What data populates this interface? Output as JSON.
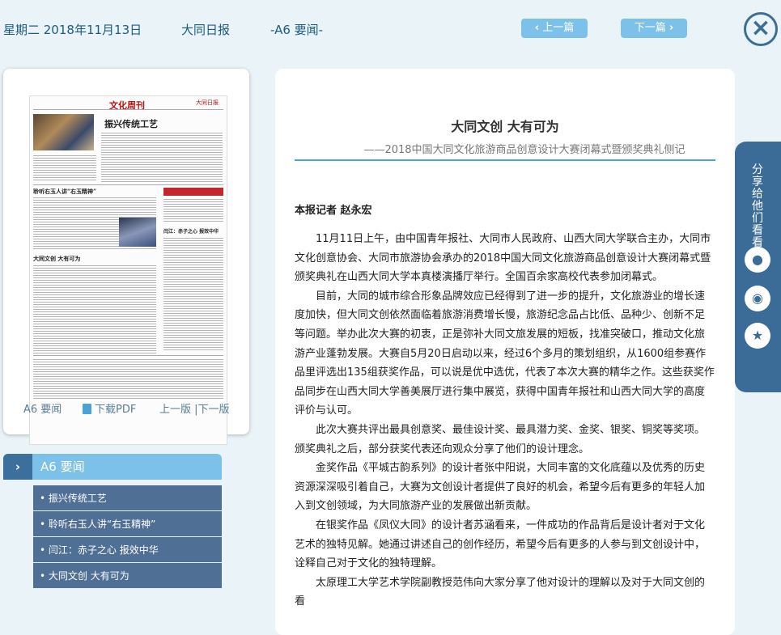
{
  "header": {
    "date": "星期二 2018年11月13日",
    "paper": "大同日报",
    "section": "-A6 要闻-",
    "prev_label": "上一篇",
    "next_label": "下一篇"
  },
  "thumbnail": {
    "masthead": "文化周刊",
    "headlines": [
      "振兴传统工艺",
      "聆听右玉人讲“右玉精神”",
      "大同文创  大有可为",
      "闫江：赤子之心  报效中华"
    ],
    "footer_section": "A6 要闻",
    "footer_pdf": "下载PDF",
    "footer_pages": "上一版 |下一版"
  },
  "article_list": {
    "heading": "A6 要闻",
    "items": [
      "• 振兴传统工艺",
      "• 聆听右玉人讲“右玉精神”",
      "• 闫江：赤子之心 报效中华",
      "• 大同文创 大有可为"
    ]
  },
  "article": {
    "title": "大同文创 大有可为",
    "subtitle": "——2018中国大同文化旅游商品创意设计大赛闭幕式暨颁奖典礼侧记",
    "byline": "本报记者 赵永宏",
    "paragraphs": [
      "11月11日上午，由中国青年报社、大同市人民政府、山西大同大学联合主办，大同市文化创意协会、大同市旅游协会承办的2018中国大同文化旅游商品创意设计大赛闭幕式暨颁奖典礼在山西大同大学本真楼演播厅举行。全国百余家高校代表参加闭幕式。",
      "目前，大同的城市综合形象品牌效应已经得到了进一步的提升，文化旅游业的增长速度加快，但大同文创依然面临着旅游消费增长慢，旅游纪念品占比低、品种少、创新不足等问题。举办此次大赛的初衷，正是弥补大同文旅发展的短板，找准突破口，推动文化旅游产业蓬勃发展。大赛自5月20日启动以来，经过6个多月的策划组织，从1600组参赛作品里评选出135组获奖作品，可以说是优中选优，代表了本次大赛的精华之作。这些获奖作品同步在山西大同大学善美展厅进行集中展览，获得中国青年报社和山西大同大学的高度评价与认可。",
      "此次大赛共评出最具创意奖、最佳设计奖、最具潜力奖、金奖、银奖、铜奖等奖项。颁奖典礼之后，部分获奖代表还向观众分享了他们的设计理念。",
      "金奖作品《平城古韵系列》的设计者张中阳说，大同丰富的文化底蕴以及优秀的历史资源深深吸引着自己，大赛为文创设计者提供了良好的机会，希望今后有更多的年轻人加入到文创领域，为大同旅游产业的发展做出新贡献。",
      "在银奖作品《凤仪大同》的设计者苏涵看来，一件成功的作品背后是设计者对于文化艺术的独特见解。她通过讲述自己的创作经历，希望今后有更多的人参与到文创设计中，诠释自己对于文化的独特理解。",
      "太原理工大学艺术学院副教授范伟向大家分享了他对设计的理解以及对于大同文创的看"
    ]
  },
  "share": {
    "label": "分享给他们看看",
    "icons": [
      "wechat-icon",
      "weibo-icon",
      "favorite-icon"
    ]
  }
}
